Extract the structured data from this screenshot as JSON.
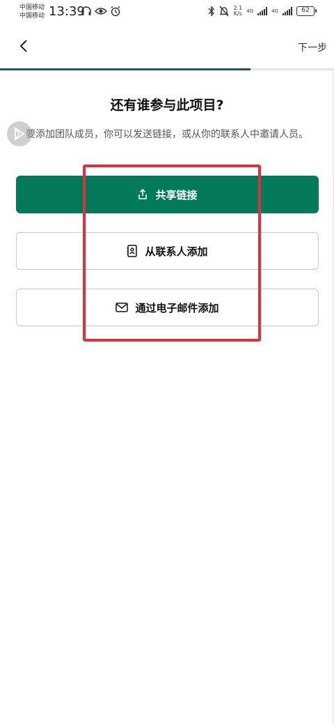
{
  "status_bar": {
    "carrier_1": "中国移动",
    "carrier_2": "中国移动",
    "time": "13:39",
    "speed_value": "2.1",
    "speed_unit": "K/s",
    "network_1": "4G",
    "network_2": "4G",
    "battery": "62"
  },
  "header": {
    "next_label": "下一步",
    "progress": 0.75
  },
  "content": {
    "title": "还有谁参与此项目?",
    "subtitle": "要添加团队成员，你可以发送链接，或从你的联系人中邀请人员。"
  },
  "actions": {
    "share_link": "共享链接",
    "from_contacts": "从联系人添加",
    "via_email": "通过电子邮件添加"
  },
  "colors": {
    "primary": "#027a5a",
    "progress": "#24506f",
    "highlight": "#e0303c"
  }
}
